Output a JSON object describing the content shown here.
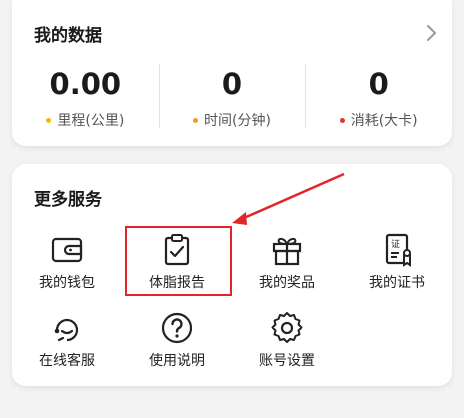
{
  "data_card": {
    "title": "我的数据",
    "stats": [
      {
        "value": "0.00",
        "label": "里程(公里)",
        "dot_color": "#f5b800"
      },
      {
        "value": "0",
        "label": "时间(分钟)",
        "dot_color": "#f39a2d"
      },
      {
        "value": "0",
        "label": "消耗(大卡)",
        "dot_color": "#e8322f"
      }
    ]
  },
  "services_card": {
    "title": "更多服务",
    "items": [
      {
        "label": "我的钱包",
        "icon": "wallet-icon"
      },
      {
        "label": "体脂报告",
        "icon": "clipboard-check-icon"
      },
      {
        "label": "我的奖品",
        "icon": "gift-icon"
      },
      {
        "label": "我的证书",
        "icon": "certificate-icon"
      },
      {
        "label": "在线客服",
        "icon": "customer-service-icon"
      },
      {
        "label": "使用说明",
        "icon": "help-icon"
      },
      {
        "label": "账号设置",
        "icon": "settings-gear-icon"
      }
    ]
  },
  "colors": {
    "highlight": "#e0262a",
    "card_bg": "#ffffff",
    "page_bg": "#f3f3f3"
  }
}
